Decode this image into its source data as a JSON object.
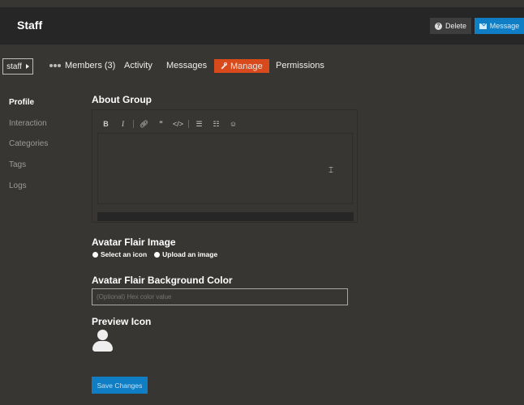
{
  "header": {
    "title": "Staff",
    "delete_label": "Delete",
    "message_label": "Message"
  },
  "nav": {
    "group_selector": "staff",
    "tabs": [
      {
        "label": "Members (3)"
      },
      {
        "label": "Activity"
      },
      {
        "label": "Messages"
      },
      {
        "label": "Manage"
      },
      {
        "label": "Permissions"
      }
    ]
  },
  "sidebar": {
    "items": [
      {
        "label": "Profile"
      },
      {
        "label": "Interaction"
      },
      {
        "label": "Categories"
      },
      {
        "label": "Tags"
      },
      {
        "label": "Logs"
      }
    ]
  },
  "form": {
    "about_label": "About Group",
    "editor_toolbar": [
      "B",
      "I",
      "link",
      "quote",
      "code",
      "bulleted-list",
      "numbered-list",
      "emoji"
    ],
    "editor_value": "",
    "avatar_flair_label": "Avatar Flair Image",
    "radio_icon": "Select an icon",
    "radio_upload": "Upload an image",
    "bg_color_label": "Avatar Flair Background Color",
    "bg_color_placeholder": "(Optional) Hex color value",
    "preview_label": "Preview Icon",
    "save_label": "Save Changes"
  },
  "colors": {
    "background": "#383632",
    "accent_blue": "#0f7ec4",
    "manage_tab": "#d84a1b"
  }
}
